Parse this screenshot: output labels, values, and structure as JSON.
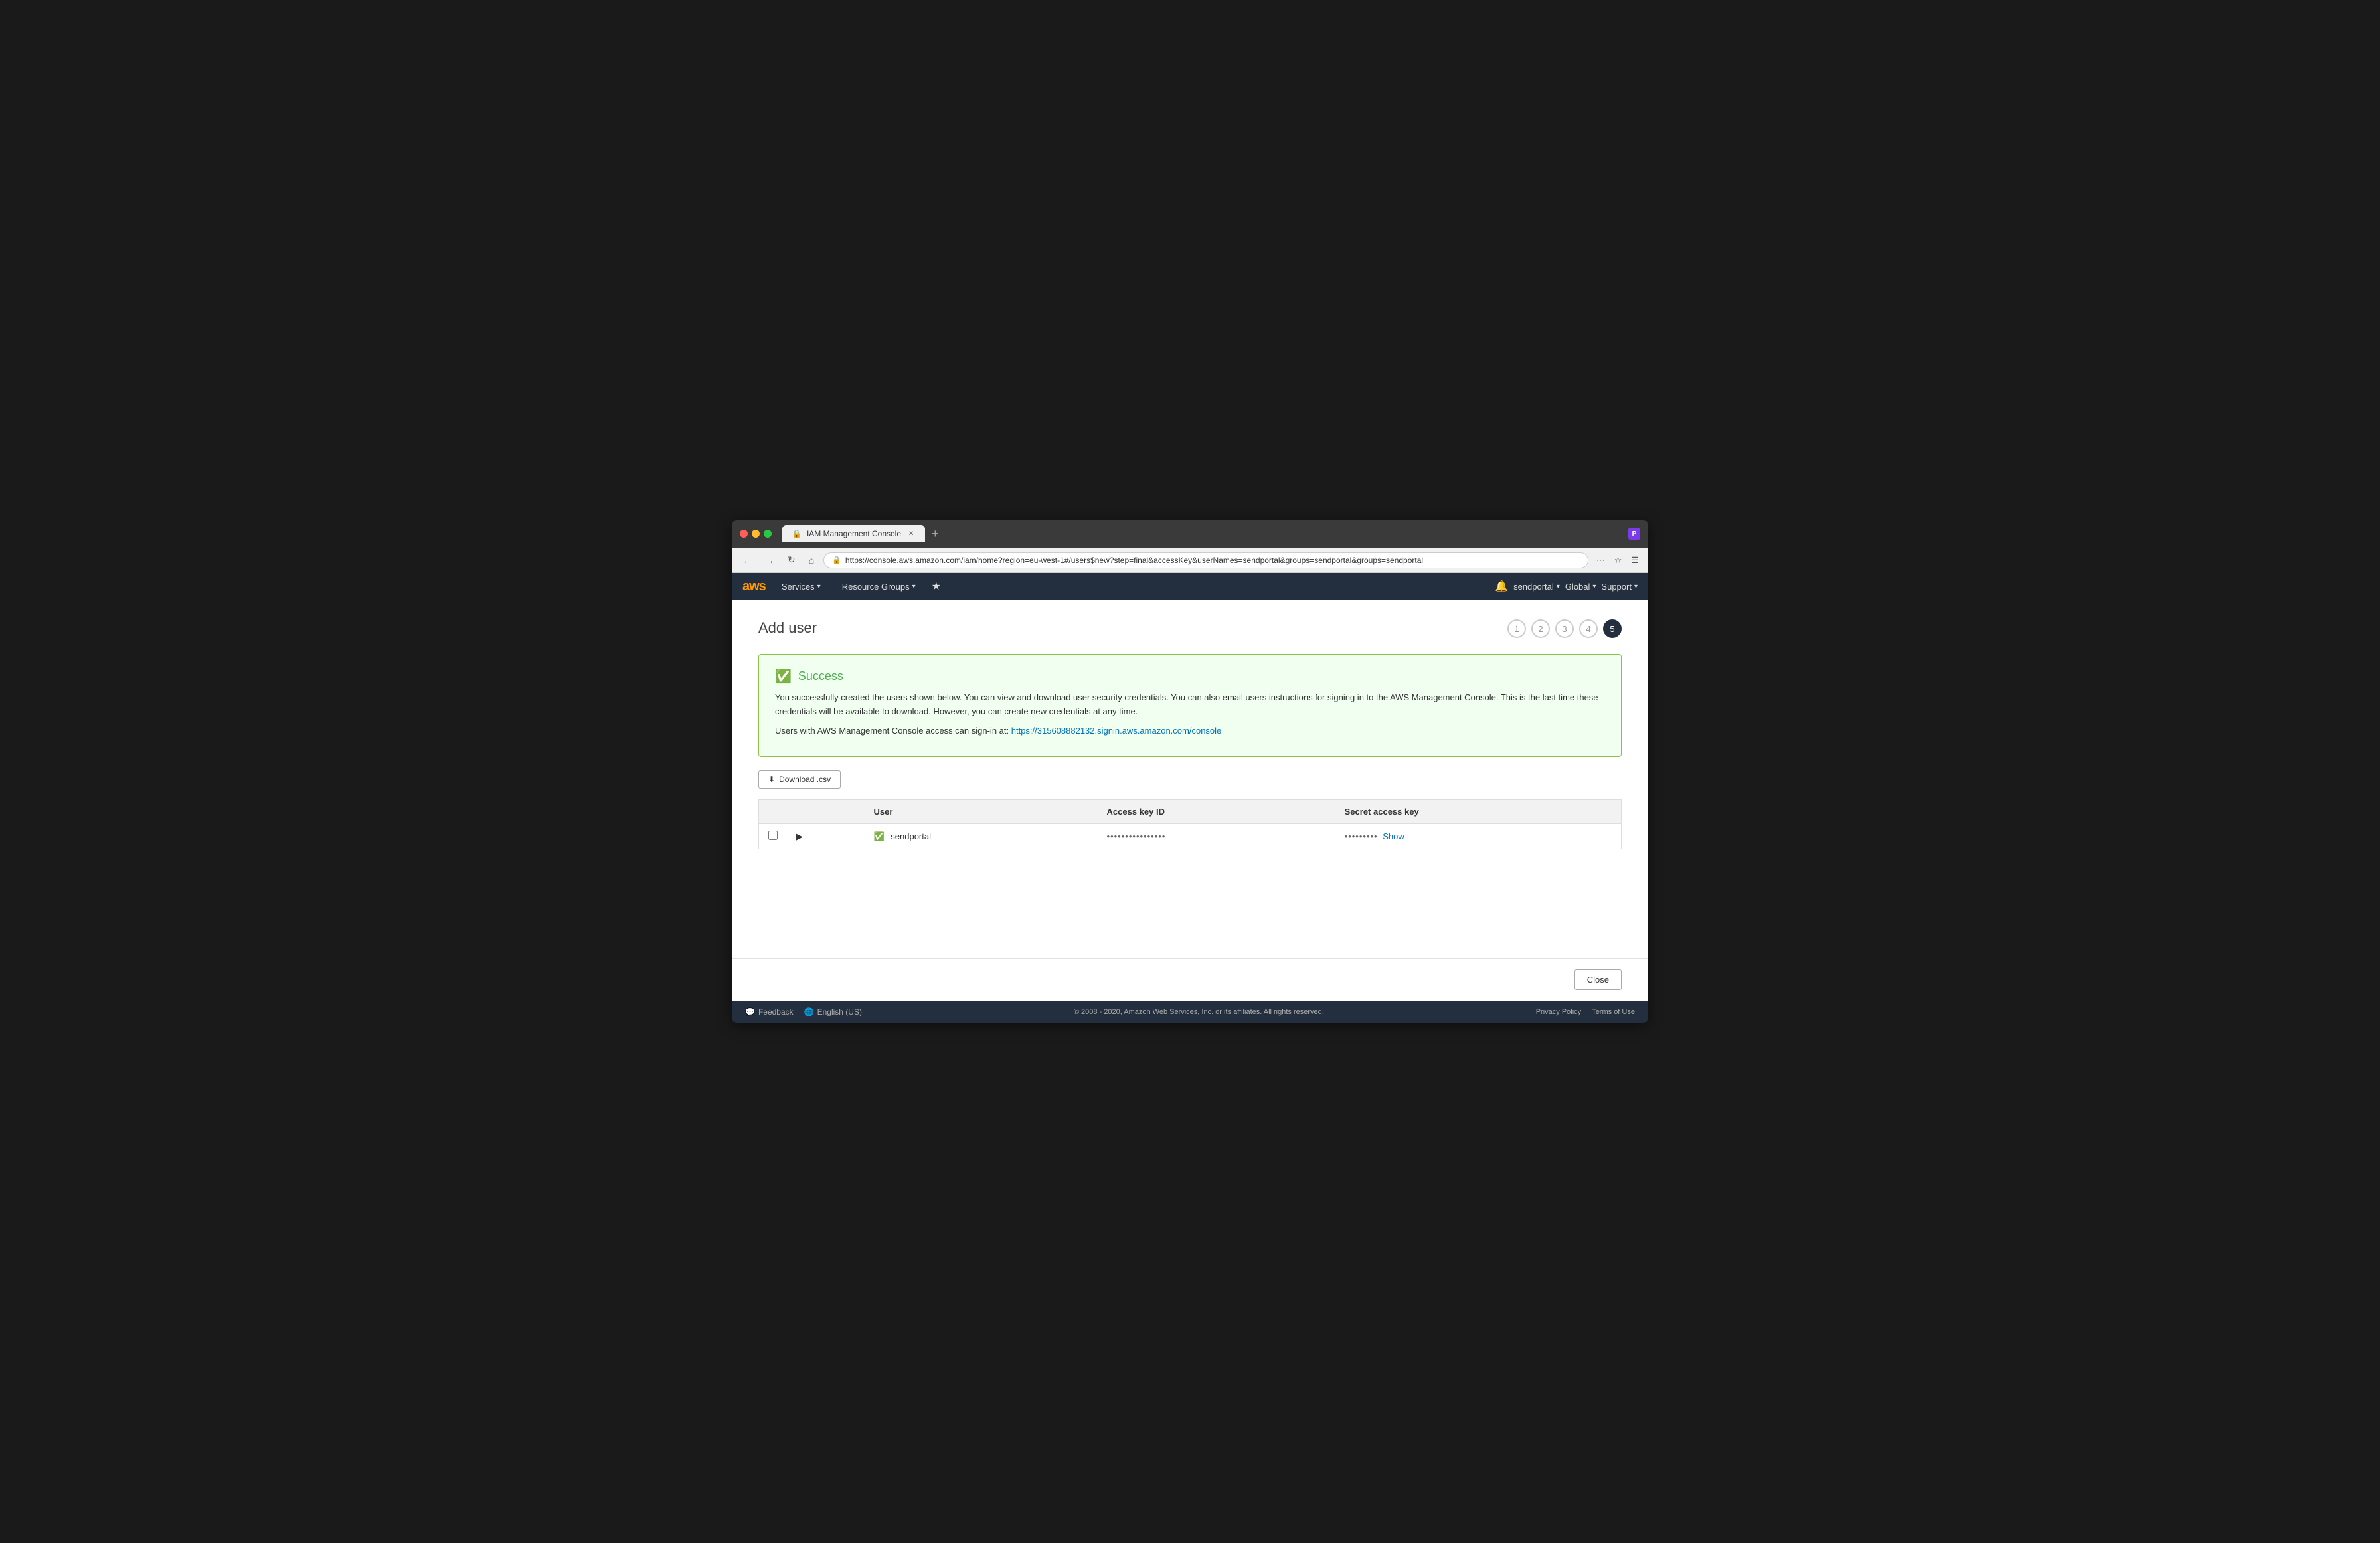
{
  "browser": {
    "tab_label": "IAM Management Console",
    "url": "https://console.aws.amazon.com/iam/home?region=eu-west-1#/users$new?step=final&accessKey&userNames=sendportal&groups=sendportal&groups=sendportal",
    "new_tab_icon": "+",
    "back_disabled": true,
    "forward_disabled": true
  },
  "aws_nav": {
    "logo_text": "aws",
    "services_label": "Services",
    "resource_groups_label": "Resource Groups",
    "bell_label": "notifications",
    "user_label": "sendportal",
    "region_label": "Global",
    "support_label": "Support"
  },
  "page": {
    "title": "Add user",
    "steps": [
      "1",
      "2",
      "3",
      "4",
      "5"
    ],
    "active_step": 5
  },
  "success_banner": {
    "title": "Success",
    "message": "You successfully created the users shown below. You can view and download user security credentials. You can also email users instructions for signing in to the AWS Management Console. This is the last time these credentials will be available to download. However, you can create new credentials at any time.",
    "console_text": "Users with AWS Management Console access can sign-in at: ",
    "console_link": "https://315608882132.signin.aws.amazon.com/console"
  },
  "download_btn_label": "Download .csv",
  "table": {
    "headers": [
      "",
      "User",
      "Access key ID",
      "Secret access key"
    ],
    "rows": [
      {
        "user": "sendportal",
        "access_key_id": "••••••••••••••••",
        "secret_access_key_masked": "•••••••••",
        "show_label": "Show",
        "success": true
      }
    ]
  },
  "close_btn_label": "Close",
  "footer": {
    "feedback_label": "Feedback",
    "language_label": "English (US)",
    "copyright": "© 2008 - 2020, Amazon Web Services, Inc. or its affiliates. All rights reserved.",
    "privacy_label": "Privacy Policy",
    "terms_label": "Terms of Use"
  }
}
